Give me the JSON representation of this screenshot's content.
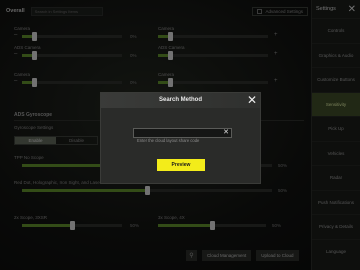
{
  "topbar": {
    "title": "Overall",
    "search_placeholder": "Search in Settings Items",
    "advanced_label": "Advanced Settings"
  },
  "settings_rows": [
    {
      "label": "Camera",
      "value": "0%"
    },
    {
      "label": "Camera",
      "value": "0%"
    },
    {
      "label": "ADS Camera",
      "value": "0%"
    },
    {
      "label": "ADS Camera",
      "value": "0%"
    },
    {
      "label": "Camera",
      "value": "0%"
    },
    {
      "label": "Camera",
      "value": "0%"
    }
  ],
  "section": {
    "title": "ADS Gyroscope",
    "toggle_label": "Gyroscope Settings",
    "toggle_options": [
      "Enable",
      "Disable"
    ]
  },
  "lower_rows": [
    {
      "label": "TPP No Scope",
      "value": "50%"
    },
    {
      "label": "Red Dot, Holographic, Iron Sight, and Laser",
      "value": "50%"
    },
    {
      "label": "2x Scope, 3XSR",
      "value": "50%"
    },
    {
      "label": "3x Scope, 4X",
      "value": "50%"
    }
  ],
  "sidebar": {
    "title": "Settings",
    "items": [
      "Controls",
      "Graphics & Audio",
      "Customize Buttons",
      "Sensitivity",
      "Pick Up",
      "Vehicles",
      "Radar",
      "Push Notifications",
      "Privacy & Details",
      "Language"
    ],
    "active_index": 3
  },
  "bottombar": {
    "cloud_management": "Cloud Management",
    "upload_to_cloud": "Upload to Cloud"
  },
  "modal": {
    "title": "Search Method",
    "input_placeholder": "Enter the cloud layout share code",
    "preview_label": "Preview",
    "accent_color": "#f3ec1a"
  }
}
